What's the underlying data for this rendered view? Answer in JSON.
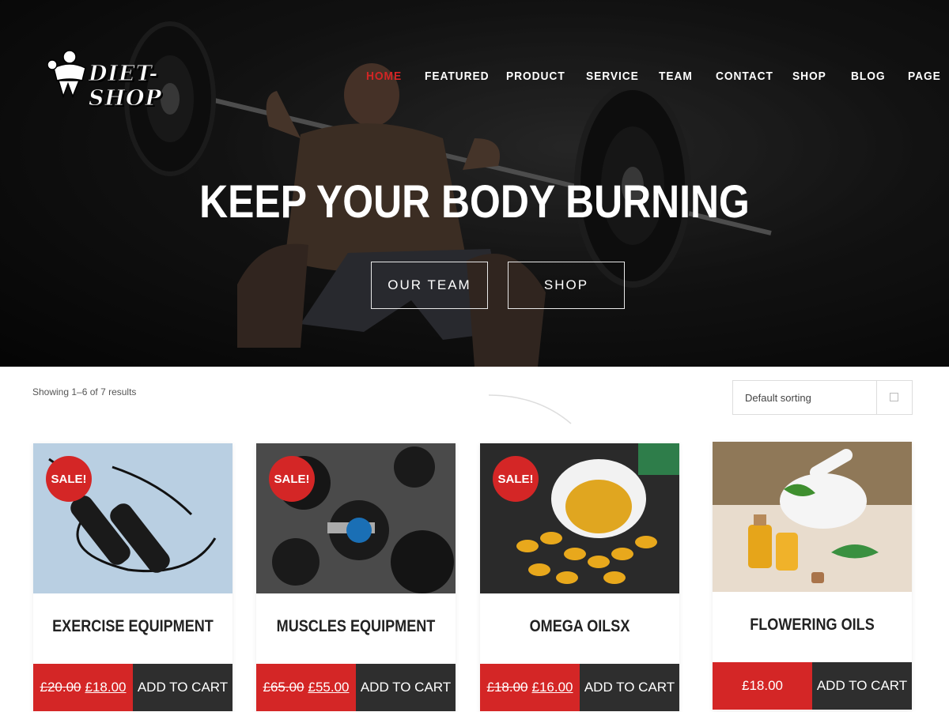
{
  "header": {
    "logo_text": "DIET-SHOP",
    "nav": [
      "HOME",
      "FEATURED",
      "PRODUCT",
      "SERVICE",
      "TEAM",
      "CONTACT",
      "SHOP",
      "BLOG",
      "PAGE"
    ],
    "active_nav": "HOME"
  },
  "hero": {
    "headline": "KEEP YOUR BODY BURNING",
    "buttons": [
      "OUR TEAM",
      "SHOP"
    ]
  },
  "shop": {
    "result_count": "Showing 1–6 of 7 results",
    "sort_value": "Default sorting"
  },
  "products": [
    {
      "title": "EXERCISE EQUIPMENT",
      "old_price": "£20.00",
      "price": "£18.00",
      "sale": "SALE!",
      "cart": "ADD TO CART"
    },
    {
      "title": "MUSCLES EQUIPMENT",
      "old_price": "£65.00",
      "price": "£55.00",
      "sale": "SALE!",
      "cart": "ADD TO CART"
    },
    {
      "title": "OMEGA OILSX",
      "old_price": "£18.00",
      "price": "£16.00",
      "sale": "SALE!",
      "cart": "ADD TO CART"
    },
    {
      "title": "FLOWERING OILS",
      "old_price": "",
      "price": "£18.00",
      "sale": "",
      "cart": "ADD TO CART"
    }
  ],
  "colors": {
    "accent": "#d42626",
    "dark": "#2e2e2e"
  }
}
